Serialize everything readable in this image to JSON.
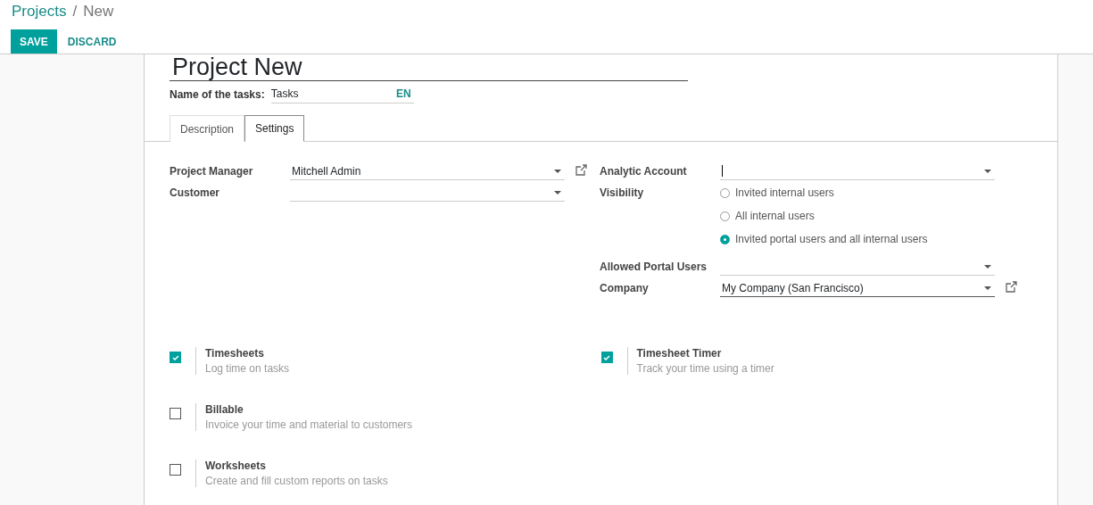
{
  "breadcrumb": [
    {
      "label": "Projects",
      "kind": "link"
    },
    {
      "label": "/",
      "kind": "separator"
    },
    {
      "label": "New",
      "kind": "current"
    }
  ],
  "buttons": [
    {
      "label": "SAVE",
      "kind": "primary"
    },
    {
      "label": "DISCARD",
      "kind": "link"
    }
  ],
  "title": "Project New",
  "task_name": {
    "label": "Name of the tasks:",
    "value": "Tasks",
    "language": "EN"
  },
  "tabs": [
    {
      "label": "Description",
      "selected": false
    },
    {
      "label": "Settings",
      "selected": true
    }
  ],
  "left_fields": [
    {
      "label": "Project Manager",
      "kind": "select",
      "value": "Mitchell Admin",
      "external_link": true
    },
    {
      "label": "Customer",
      "kind": "select",
      "external_link": false
    }
  ],
  "right_fields": [
    {
      "label": "Analytic Account",
      "kind": "select",
      "focused": true,
      "external_link": false
    },
    {
      "label": "Visibility",
      "kind": "radio",
      "options": [
        {
          "label": "Invited internal users",
          "selected": false
        },
        {
          "label": "All internal users",
          "selected": false
        },
        {
          "label": "Invited portal users and all internal users",
          "selected": true
        }
      ]
    },
    {
      "label": "Allowed Portal Users",
      "kind": "select",
      "external_link": false
    },
    {
      "label": "Company",
      "kind": "select",
      "value": "My Company (San Francisco)",
      "focused": false,
      "external_link": true
    }
  ],
  "settings": [
    [
      {
        "label": "Timesheets",
        "description": "Log time on tasks",
        "checked": true
      },
      {
        "label": "Timesheet Timer",
        "description": "Track your time using a timer",
        "checked": true
      }
    ],
    [
      {
        "label": "Billable",
        "description": "Invoice your time and material to customers",
        "checked": false
      }
    ],
    [
      {
        "label": "Worksheets",
        "description": "Create and fill custom reports on tasks",
        "checked": false
      }
    ]
  ]
}
